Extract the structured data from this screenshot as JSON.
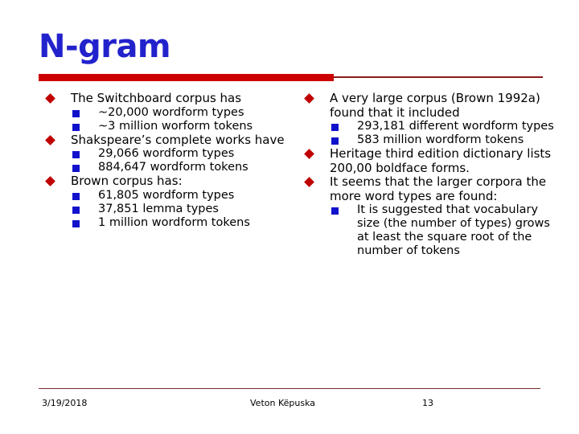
{
  "slide": {
    "title": "N-gram",
    "title_color": "#2222CC",
    "accent_bar_color": "#CC0000",
    "accent_rule_color": "#8B1A1A",
    "bullet_level1_color": "#C00000",
    "bullet_level2_color": "#1111CC",
    "bullet_level1_icon": "red-diamond-bullet-icon",
    "bullet_level2_icon": "blue-square-bullet-icon"
  },
  "left_column": [
    {
      "text": "The Switchboard corpus has",
      "children": [
        "~20,000 wordform types",
        "~3 million worform tokens"
      ]
    },
    {
      "text": "Shakspeare’s complete works have",
      "children": [
        "29,066 wordform types",
        "884,647 wordform tokens"
      ]
    },
    {
      "text": "Brown corpus has:",
      "children": [
        "61,805 wordform types",
        "37,851 lemma types",
        "1 million wordform tokens"
      ]
    }
  ],
  "right_column": [
    {
      "text": "A very large corpus (Brown 1992a) found that it included",
      "children": [
        "293,181 different wordform types",
        "583 million wordform tokens"
      ]
    },
    {
      "text": "Heritage third edition dictionary lists 200,00 boldface forms.",
      "children": []
    },
    {
      "text": "It seems that the larger corpora the more word types are found:",
      "children": [
        "It is suggested that vocabulary size (the number of types) grows at least the square root of the number of tokens"
      ]
    }
  ],
  "footer": {
    "date": "3/19/2018",
    "author": "Veton Këpuska",
    "page_number": "13"
  }
}
